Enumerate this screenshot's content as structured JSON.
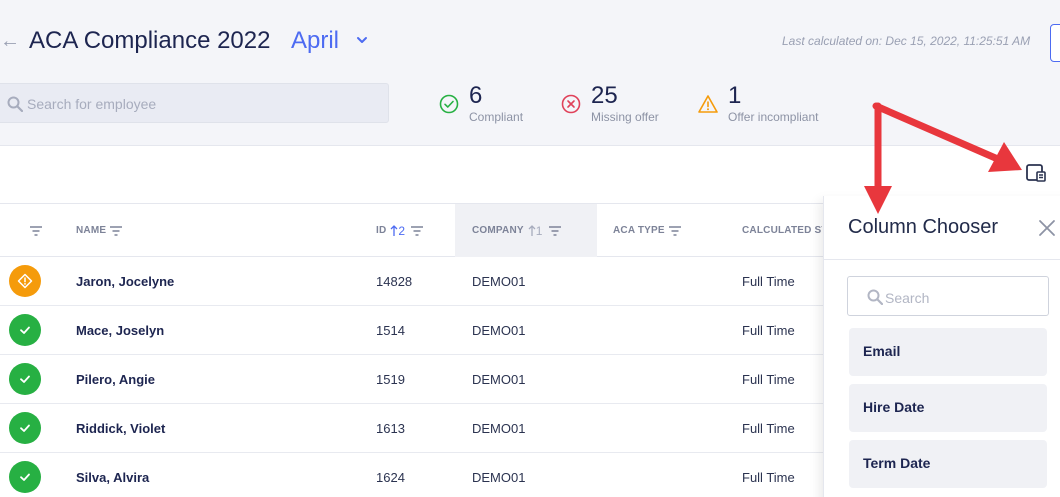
{
  "header": {
    "back_glyph": "←",
    "title": "ACA Compliance 2022",
    "month": "April",
    "last_calculated": "Last calculated on: Dec 15, 2022, 11:25:51 AM"
  },
  "search": {
    "placeholder": "Search for employee"
  },
  "stats": [
    {
      "value": "6",
      "label": "Compliant",
      "icon": "check-circle-icon",
      "color": "#27b043"
    },
    {
      "value": "25",
      "label": "Missing offer",
      "icon": "x-circle-icon",
      "color": "#e0415a"
    },
    {
      "value": "1",
      "label": "Offer incompliant",
      "icon": "warning-triangle-icon",
      "color": "#f59b0b"
    }
  ],
  "table": {
    "columns": {
      "name": "NAME",
      "id": "ID",
      "id_sort": "2",
      "company": "COMPANY",
      "company_sort": "1",
      "aca_type": "ACA TYPE",
      "calculated": "CALCULATED ST"
    },
    "rows": [
      {
        "status": "warning",
        "name": "Jaron, Jocelyne",
        "id": "14828",
        "company": "DEMO01",
        "calculated": "Full Time"
      },
      {
        "status": "compliant",
        "name": "Mace, Joselyn",
        "id": "1514",
        "company": "DEMO01",
        "calculated": "Full Time"
      },
      {
        "status": "compliant",
        "name": "Pilero, Angie",
        "id": "1519",
        "company": "DEMO01",
        "calculated": "Full Time"
      },
      {
        "status": "compliant",
        "name": "Riddick, Violet",
        "id": "1613",
        "company": "DEMO01",
        "calculated": "Full Time"
      },
      {
        "status": "compliant",
        "name": "Silva, Alvira",
        "id": "1624",
        "company": "DEMO01",
        "calculated": "Full Time"
      }
    ]
  },
  "column_chooser": {
    "title": "Column Chooser",
    "search_placeholder": "Search",
    "items": [
      "Email",
      "Hire Date",
      "Term Date"
    ]
  },
  "colors": {
    "accent": "#4d6bf2",
    "arrow": "#e8373d",
    "ok": "#27b043",
    "warn": "#f59b0b"
  }
}
